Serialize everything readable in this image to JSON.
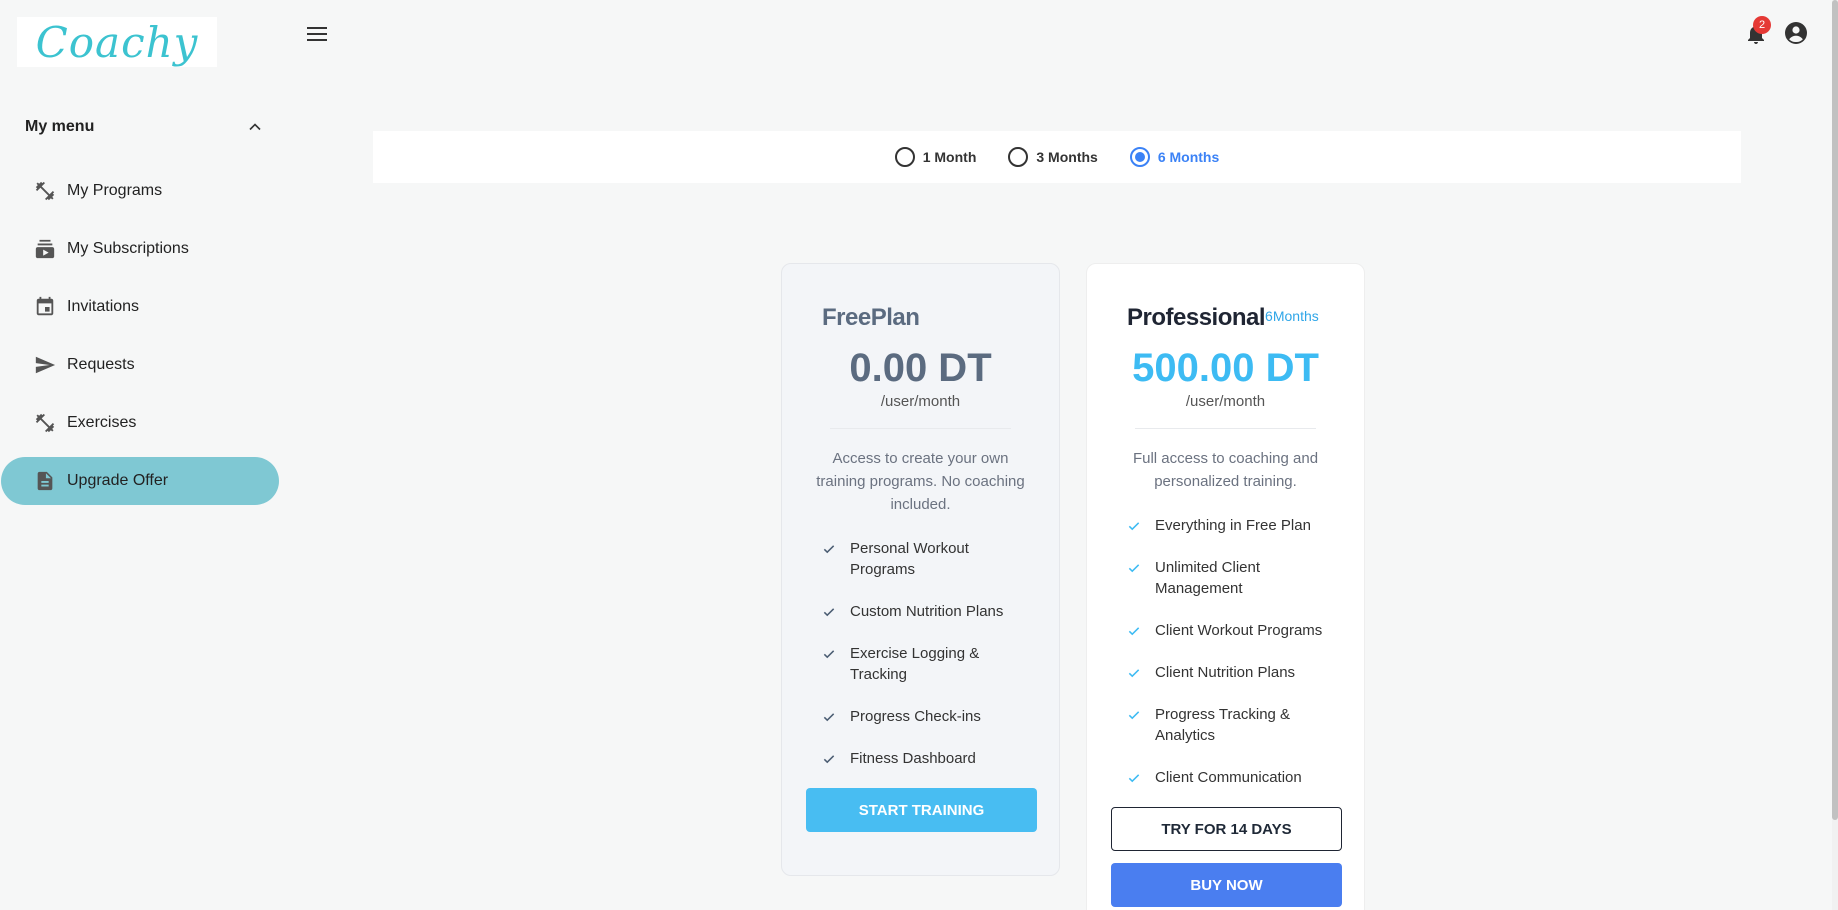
{
  "header": {
    "logo_text": "Coachy",
    "notification_count": "2"
  },
  "sidebar": {
    "menu_title": "My menu",
    "items": [
      {
        "label": "My Programs",
        "icon": "dumbbell-icon"
      },
      {
        "label": "My Subscriptions",
        "icon": "subscriptions-icon"
      },
      {
        "label": "Invitations",
        "icon": "calendar-icon"
      },
      {
        "label": "Requests",
        "icon": "send-icon"
      },
      {
        "label": "Exercises",
        "icon": "dumbbell-icon"
      },
      {
        "label": "Upgrade Offer",
        "icon": "document-icon",
        "active": true
      }
    ]
  },
  "duration": {
    "options": [
      "1 Month",
      "3 Months",
      "6 Months"
    ],
    "selected": "6 Months"
  },
  "plans": {
    "free": {
      "name": "FreePlan",
      "price": "0.00 DT",
      "per": "/user/month",
      "description": "Access to create your own training programs. No coaching included.",
      "features": [
        "Personal Workout Programs",
        "Custom Nutrition Plans",
        "Exercise Logging & Tracking",
        "Progress Check-ins",
        "Fitness Dashboard"
      ],
      "button": "START TRAINING"
    },
    "pro": {
      "name": "Professional",
      "period": "6Months",
      "price": "500.00 DT",
      "per": "/user/month",
      "description": "Full access to coaching and personalized training.",
      "features": [
        "Everything in Free Plan",
        "Unlimited Client Management",
        "Client Workout Programs",
        "Client Nutrition Plans",
        "Progress Tracking & Analytics",
        "Client Communication"
      ],
      "trial_button": "TRY FOR 14 DAYS",
      "buy_button": "BUY NOW"
    }
  },
  "colors": {
    "accent": "#3b82f6",
    "active_nav": "#7fc8d3",
    "pro_price": "#3dbbf3",
    "start_button": "#48bdf2",
    "buy_button": "#4a7ef0"
  }
}
